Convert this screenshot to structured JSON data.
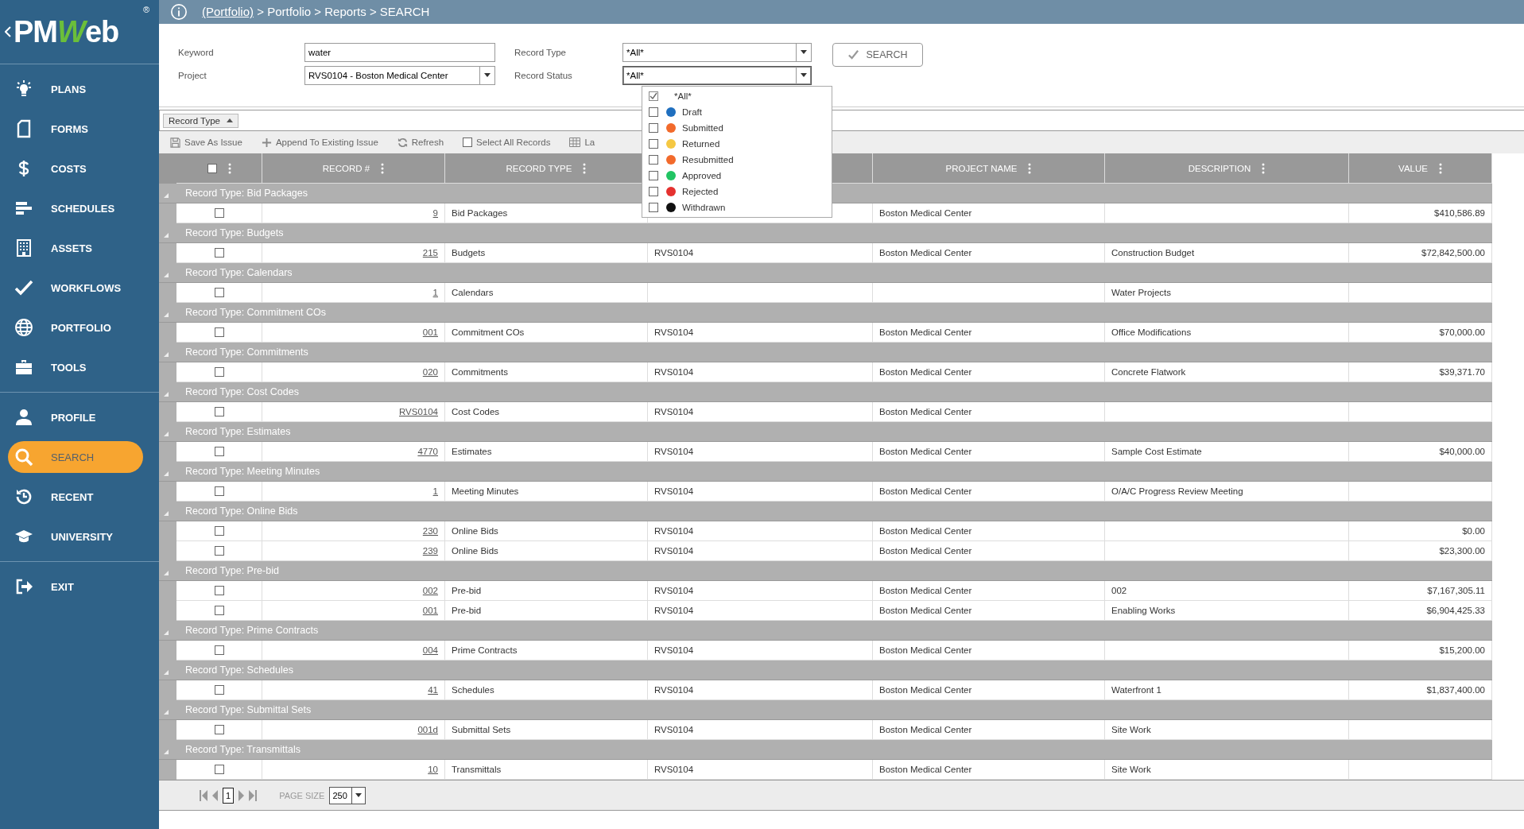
{
  "logo": {
    "prefix": "PM",
    "accent": "W",
    "suffix": "eb",
    "registered": "®"
  },
  "sidebar": {
    "sections": [
      [
        {
          "label": "PLANS",
          "selected": false
        },
        {
          "label": "FORMS",
          "selected": false
        },
        {
          "label": "COSTS",
          "selected": false
        },
        {
          "label": "SCHEDULES",
          "selected": false
        },
        {
          "label": "ASSETS",
          "selected": false
        },
        {
          "label": "WORKFLOWS",
          "selected": false
        },
        {
          "label": "PORTFOLIO",
          "selected": false
        },
        {
          "label": "TOOLS",
          "selected": false
        }
      ],
      [
        {
          "label": "PROFILE",
          "selected": false
        },
        {
          "label": "SEARCH",
          "selected": true
        },
        {
          "label": "RECENT",
          "selected": false
        },
        {
          "label": "UNIVERSITY",
          "selected": false
        }
      ],
      [
        {
          "label": "EXIT",
          "selected": false
        }
      ]
    ]
  },
  "breadcrumb": {
    "link": "(Portfolio)",
    "rest": " > Portfolio > Reports > SEARCH"
  },
  "form": {
    "keyword": {
      "label": "Keyword",
      "value": "water"
    },
    "project": {
      "label": "Project",
      "value": "RVS0104 - Boston Medical Center"
    },
    "record_type": {
      "label": "Record Type",
      "value": "*All*"
    },
    "record_status": {
      "label": "Record Status",
      "value": "*All*",
      "expanded": true,
      "options": [
        {
          "label": "*All*",
          "checked": true
        },
        {
          "label": "Draft",
          "checked": false,
          "color": "#1f6fbf"
        },
        {
          "label": "Submitted",
          "checked": false,
          "color": "#f26a2b"
        },
        {
          "label": "Returned",
          "checked": false,
          "color": "#f5c843"
        },
        {
          "label": "Resubmitted",
          "checked": false,
          "color": "#f26a2b"
        },
        {
          "label": "Approved",
          "checked": false,
          "color": "#21c463"
        },
        {
          "label": "Rejected",
          "checked": false,
          "color": "#e5312f"
        },
        {
          "label": "Withdrawn",
          "checked": false,
          "color": "#111111"
        }
      ]
    },
    "search_button": "SEARCH"
  },
  "group_by": {
    "chip": "Record Type"
  },
  "toolbar": {
    "save": "Save As Issue",
    "append": "Append To Existing Issue",
    "refresh": "Refresh",
    "select_all": {
      "label": "Select All Records",
      "checked": false
    },
    "layout": "La"
  },
  "table": {
    "header_checked": false,
    "columns": [
      "RECORD #",
      "RECORD TYPE",
      "",
      "PROJECT NAME",
      "DESCRIPTION",
      "VALUE"
    ],
    "groups": [
      {
        "label": "Record Type: Bid Packages",
        "rows": [
          {
            "checked": false,
            "record": "9",
            "type": "Bid Packages",
            "project": "",
            "project_name": "Boston Medical Center",
            "description": "",
            "value": "$410,586.89"
          }
        ]
      },
      {
        "label": "Record Type: Budgets",
        "rows": [
          {
            "checked": false,
            "record": "215",
            "type": "Budgets",
            "project": "RVS0104",
            "project_name": "Boston Medical Center",
            "description": "Construction Budget",
            "value": "$72,842,500.00"
          }
        ]
      },
      {
        "label": "Record Type: Calendars",
        "rows": [
          {
            "checked": false,
            "record": "1",
            "type": "Calendars",
            "project": "",
            "project_name": "",
            "description": "Water Projects",
            "value": ""
          }
        ]
      },
      {
        "label": "Record Type: Commitment COs",
        "rows": [
          {
            "checked": false,
            "record": "001",
            "type": "Commitment COs",
            "project": "RVS0104",
            "project_name": "Boston Medical Center",
            "description": "Office Modifications",
            "value": "$70,000.00"
          }
        ]
      },
      {
        "label": "Record Type: Commitments",
        "rows": [
          {
            "checked": false,
            "record": "020",
            "type": "Commitments",
            "project": "RVS0104",
            "project_name": "Boston Medical Center",
            "description": "Concrete Flatwork",
            "value": "$39,371.70"
          }
        ]
      },
      {
        "label": "Record Type: Cost Codes",
        "rows": [
          {
            "checked": false,
            "record": "RVS0104",
            "type": "Cost Codes",
            "project": "RVS0104",
            "project_name": "Boston Medical Center",
            "description": "",
            "value": ""
          }
        ]
      },
      {
        "label": "Record Type: Estimates",
        "rows": [
          {
            "checked": false,
            "record": "4770",
            "type": "Estimates",
            "project": "RVS0104",
            "project_name": "Boston Medical Center",
            "description": "Sample Cost Estimate",
            "value": "$40,000.00"
          }
        ]
      },
      {
        "label": "Record Type: Meeting Minutes",
        "rows": [
          {
            "checked": false,
            "record": "1",
            "type": "Meeting Minutes",
            "project": "RVS0104",
            "project_name": "Boston Medical Center",
            "description": "O/A/C Progress Review Meeting",
            "value": ""
          }
        ]
      },
      {
        "label": "Record Type: Online Bids",
        "rows": [
          {
            "checked": false,
            "record": "230",
            "type": "Online Bids",
            "project": "RVS0104",
            "project_name": "Boston Medical Center",
            "description": "",
            "value": "$0.00"
          },
          {
            "checked": false,
            "record": "239",
            "type": "Online Bids",
            "project": "RVS0104",
            "project_name": "Boston Medical Center",
            "description": "",
            "value": "$23,300.00"
          }
        ]
      },
      {
        "label": "Record Type: Pre-bid",
        "rows": [
          {
            "checked": false,
            "record": "002",
            "type": "Pre-bid",
            "project": "RVS0104",
            "project_name": "Boston Medical Center",
            "description": "002",
            "value": "$7,167,305.11"
          },
          {
            "checked": false,
            "record": "001",
            "type": "Pre-bid",
            "project": "RVS0104",
            "project_name": "Boston Medical Center",
            "description": "Enabling Works",
            "value": "$6,904,425.33"
          }
        ]
      },
      {
        "label": "Record Type: Prime Contracts",
        "rows": [
          {
            "checked": false,
            "record": "004",
            "type": "Prime Contracts",
            "project": "RVS0104",
            "project_name": "Boston Medical Center",
            "description": "",
            "value": "$15,200.00"
          }
        ]
      },
      {
        "label": "Record Type: Schedules",
        "rows": [
          {
            "checked": false,
            "record": "41",
            "type": "Schedules",
            "project": "RVS0104",
            "project_name": "Boston Medical Center",
            "description": "Waterfront 1",
            "value": "$1,837,400.00"
          }
        ]
      },
      {
        "label": "Record Type: Submittal Sets",
        "rows": [
          {
            "checked": false,
            "record": "001d",
            "type": "Submittal Sets",
            "project": "RVS0104",
            "project_name": "Boston Medical Center",
            "description": "Site Work",
            "value": ""
          }
        ]
      },
      {
        "label": "Record Type: Transmittals",
        "rows": [
          {
            "checked": false,
            "record": "10",
            "type": "Transmittals",
            "project": "RVS0104",
            "project_name": "Boston Medical Center",
            "description": "Site Work",
            "value": ""
          }
        ]
      }
    ]
  },
  "pager": {
    "page": "1",
    "page_size_label": "PAGE SIZE",
    "page_size": "250"
  }
}
